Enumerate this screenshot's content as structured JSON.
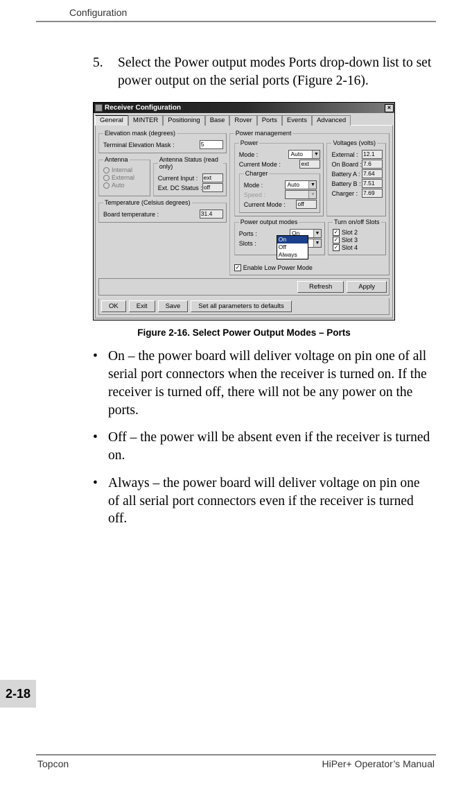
{
  "header": {
    "section": "Configuration"
  },
  "step": {
    "number": "5.",
    "text": "Select the Power output modes Ports drop-down list to set power output on the serial ports (Figure 2-16)."
  },
  "dialog": {
    "title": "Receiver Configuration",
    "tabs": [
      "General",
      "MINTER",
      "Positioning",
      "Base",
      "Rover",
      "Ports",
      "Events",
      "Advanced"
    ],
    "active_tab": "General",
    "elevation": {
      "legend": "Elevation mask (degrees)",
      "label": "Terminal Elevation Mask :",
      "value": "5"
    },
    "antenna": {
      "legend": "Antenna",
      "options": [
        "Internal",
        "External",
        "Auto"
      ],
      "status_legend": "Antenna Status (read only)",
      "current_input_label": "Current Input :",
      "current_input_value": "ext",
      "ext_dc_label": "Ext. DC Status :",
      "ext_dc_value": "off"
    },
    "temperature": {
      "legend": "Temperature (Celsius degrees)",
      "label": "Board temperature :",
      "value": "31.4"
    },
    "power_mgmt": {
      "legend": "Power management",
      "power": {
        "legend": "Power",
        "mode_label": "Mode :",
        "mode_value": "Auto",
        "current_mode_label": "Current Mode :",
        "current_mode_value": "ext"
      },
      "charger": {
        "legend": "Charger",
        "mode_label": "Mode :",
        "mode_value": "Auto",
        "speed_label": "Speed :",
        "current_mode_label": "Current Mode :",
        "current_mode_value": "off"
      },
      "voltages": {
        "legend": "Voltages (volts)",
        "rows": [
          {
            "label": "External :",
            "value": "12.1"
          },
          {
            "label": "On Board :",
            "value": "7.6"
          },
          {
            "label": "Battery A :",
            "value": "7.64"
          },
          {
            "label": "Battery B :",
            "value": "7.51"
          },
          {
            "label": "Charger :",
            "value": "7.69"
          }
        ]
      },
      "pom": {
        "legend": "Power output modes",
        "ports_label": "Ports :",
        "ports_value": "On",
        "slots_label": "Slots :",
        "options": [
          "On",
          "Off",
          "Always"
        ]
      },
      "slots": {
        "legend": "Turn on/off Slots",
        "rows": [
          "Slot 2",
          "Slot 3",
          "Slot 4"
        ]
      },
      "low_power": "Enable Low Power Mode"
    },
    "buttons_top": {
      "refresh": "Refresh",
      "apply": "Apply"
    },
    "buttons_bottom": {
      "ok": "OK",
      "exit": "Exit",
      "save": "Save",
      "defaults": "Set all parameters to defaults"
    }
  },
  "caption": "Figure 2-16. Select Power Output Modes – Ports",
  "bullets": [
    "On – the power board will deliver voltage on pin one of all serial port connectors when the receiver is turned on. If the receiver is turned off, there will not be any power on the ports.",
    "Off – the power will be absent even if the receiver is turned on.",
    "Always – the power board will deliver voltage on pin one of all serial port connectors even if the receiver is turned off."
  ],
  "page_number": "2-18",
  "footer": {
    "left": "Topcon",
    "right": "HiPer+ Operator’s Manual"
  }
}
